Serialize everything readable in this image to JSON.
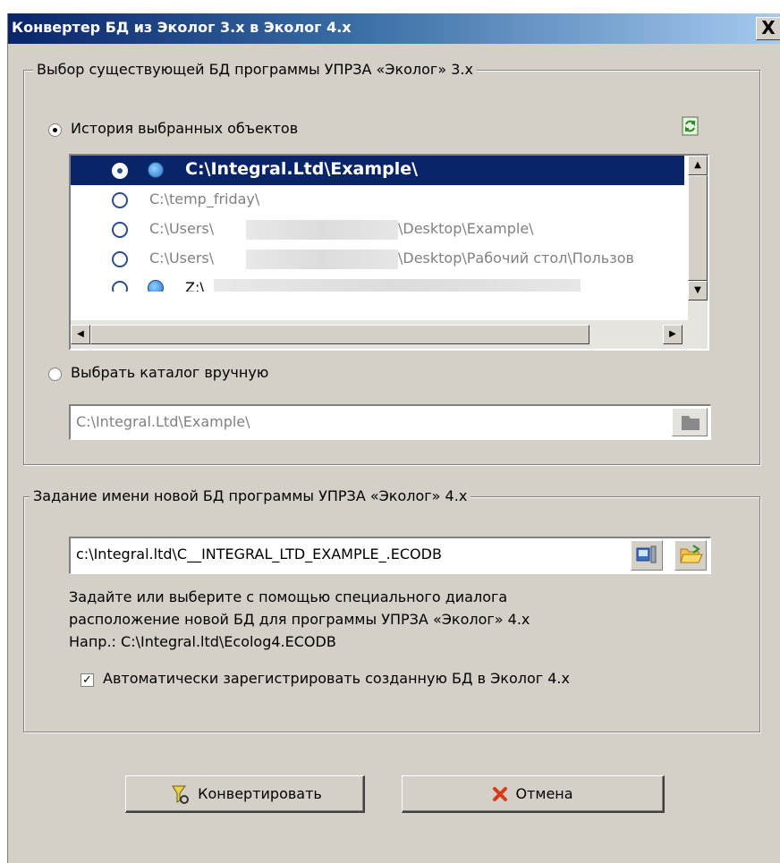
{
  "window": {
    "title": "Конвертер БД из  Эколог 3.x в Эколог 4.x",
    "close": "X"
  },
  "source_group": {
    "legend": "Выбор существующей БД программы УПРЗА «Эколог» 3.x",
    "history_option": "История выбранных объектов",
    "history_items": [
      "C:\\Integral.Ltd\\Example\\",
      "C:\\temp_friday\\",
      "C:\\Users\\",
      "\\Desktop\\Example\\",
      "C:\\Users\\",
      "\\Desktop\\Рабочий стол\\Пользов",
      "Z:\\"
    ],
    "manual_option": "Выбрать каталог вручную",
    "manual_path": "C:\\Integral.Ltd\\Example\\"
  },
  "target_group": {
    "legend": "Задание имени новой БД программы УПРЗА «Эколог» 4.x",
    "path": "c:\\Integral.ltd\\C__INTEGRAL_LTD_EXAMPLE_.ECODB",
    "hint_line1": "Задайте или выберите с помощью специального диалога",
    "hint_line2": "расположение новой БД для программы УПРЗА «Эколог» 4.x",
    "hint_line3": "Напр.: C:\\Integral.ltd\\Ecolog4.ECODB",
    "auto_register": "Автоматически зарегистрировать созданную БД в Эколог 4.x"
  },
  "buttons": {
    "convert": "Конвертировать",
    "cancel": "Отмена"
  }
}
